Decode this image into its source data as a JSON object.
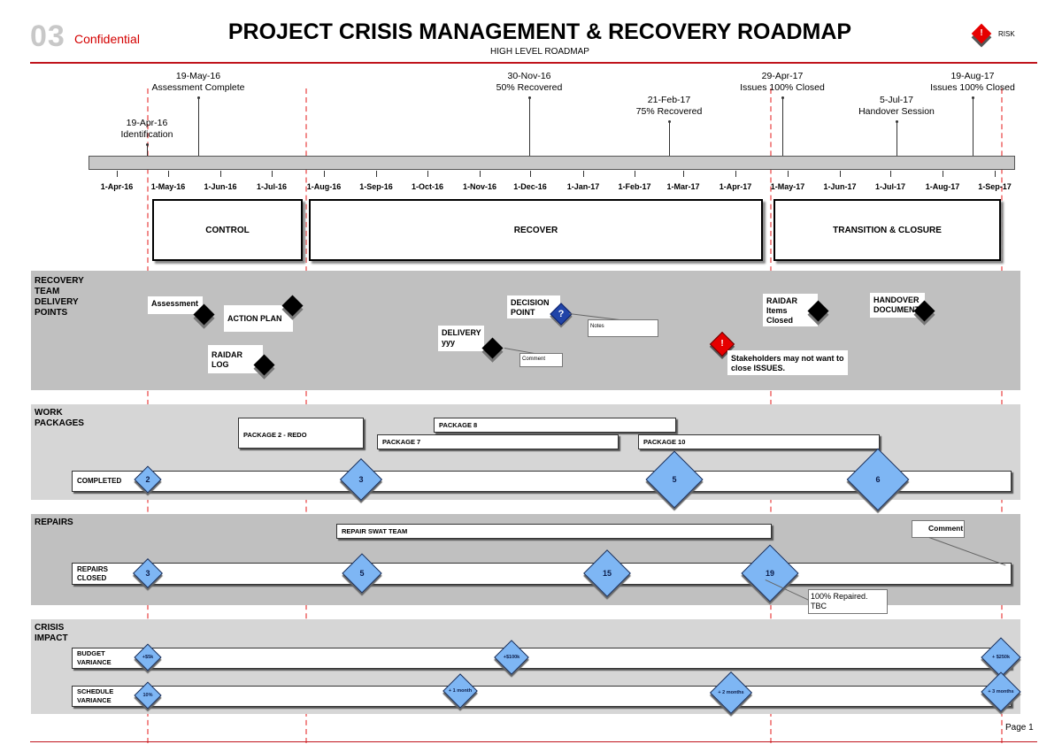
{
  "header": {
    "page_number": "03",
    "classification": "Confidential",
    "title": "PROJECT CRISIS MANAGEMENT & RECOVERY ROADMAP",
    "subtitle": "HIGH LEVEL ROADMAP",
    "legend": {
      "icon": "risk-diamond-icon",
      "label": "RISK",
      "color": "#e60000"
    }
  },
  "milestones": [
    {
      "date": "19-Apr-16",
      "label": "Identification"
    },
    {
      "date": "19-May-16",
      "label": "Assessment Complete"
    },
    {
      "date": "30-Nov-16",
      "label": "50% Recovered"
    },
    {
      "date": "21-Feb-17",
      "label": "75% Recovered"
    },
    {
      "date": "29-Apr-17",
      "label": "Issues 100% Closed"
    },
    {
      "date": "5-Jul-17",
      "label": "Handover Session"
    },
    {
      "date": "19-Aug-17",
      "label": "Issues 100% Closed"
    }
  ],
  "timeline": {
    "ticks": [
      "1-Apr-16",
      "1-May-16",
      "1-Jun-16",
      "1-Jul-16",
      "1-Aug-16",
      "1-Sep-16",
      "1-Oct-16",
      "1-Nov-16",
      "1-Dec-16",
      "1-Jan-17",
      "1-Feb-17",
      "1-Mar-17",
      "1-Apr-17",
      "1-May-17",
      "1-Jun-17",
      "1-Jul-17",
      "1-Aug-17",
      "1-Sep-17"
    ]
  },
  "phases": [
    {
      "label": "CONTROL"
    },
    {
      "label": "RECOVER"
    },
    {
      "label": "TRANSITION & CLOSURE"
    }
  ],
  "swimlanes": {
    "delivery": {
      "label": [
        "RECOVERY",
        "TEAM",
        "DELIVERY",
        "POINTS"
      ],
      "items": [
        {
          "lines": [
            "Assessment"
          ],
          "icon": "deliverable-diamond-icon"
        },
        {
          "lines": [
            "ACTION PLAN"
          ],
          "icon": "deliverable-diamond-icon"
        },
        {
          "lines": [
            "RAIDAR",
            "LOG"
          ],
          "icon": "deliverable-diamond-icon"
        },
        {
          "lines": [
            "DECISION",
            "POINT"
          ],
          "icon": "decision-diamond-icon",
          "glyph": "?",
          "note": "Notes"
        },
        {
          "lines": [
            "DELIVERY",
            "yyy"
          ],
          "icon": "deliverable-diamond-icon",
          "note": "Comment"
        },
        {
          "lines": [
            "RAIDAR",
            "Items",
            "Closed"
          ],
          "icon": "deliverable-diamond-icon"
        },
        {
          "lines": [
            "HANDOVER",
            "DOCUMENT"
          ],
          "icon": "deliverable-diamond-icon"
        }
      ],
      "risk": {
        "glyph": "!",
        "lines": [
          "Stakeholders may not want to",
          "close ISSUES."
        ]
      }
    },
    "work_packages": {
      "label": [
        "WORK",
        "PACKAGES"
      ],
      "packages": [
        "PACKAGE 2 - REDO",
        "PACKAGE 8",
        "PACKAGE 7",
        "PACKAGE 10"
      ],
      "track_label": "COMPLETED",
      "counts": [
        "2",
        "3",
        "5",
        "6"
      ]
    },
    "repairs": {
      "label": [
        "REPAIRS"
      ],
      "team": "REPAIR SWAT TEAM",
      "track_label": [
        "REPAIRS",
        "CLOSED"
      ],
      "counts": [
        "3",
        "5",
        "15",
        "19"
      ],
      "comment": "Comment",
      "note": [
        "100% Repaired.",
        "TBC"
      ]
    },
    "crisis_impact": {
      "label": [
        "CRISIS",
        "IMPACT"
      ],
      "budget": {
        "label": [
          "BUDGET",
          "VARIANCE"
        ],
        "points": [
          "+$5k",
          "+$100k",
          "+ $250k"
        ]
      },
      "schedule": {
        "label": [
          "SCHEDULE",
          "VARIANCE"
        ],
        "points": [
          "10%",
          "+ 1 month",
          "+ 2 months",
          "+ 3 months"
        ]
      }
    }
  },
  "footer": {
    "page": "Page 1"
  }
}
